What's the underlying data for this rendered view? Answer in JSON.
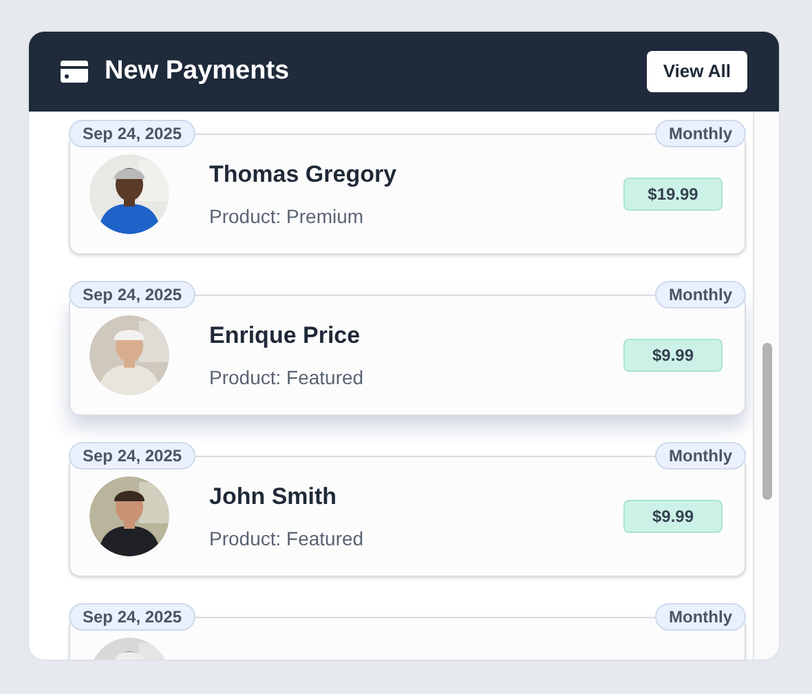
{
  "panel": {
    "title": "New Payments",
    "action": "View All"
  },
  "payments": [
    {
      "date": "Sep 24, 2025",
      "plan": "Monthly",
      "name": "Thomas Gregory",
      "product": "Product: Premium",
      "amount": "$19.99",
      "selected": false
    },
    {
      "date": "Sep 24, 2025",
      "plan": "Monthly",
      "name": "Enrique Price",
      "product": "Product: Featured",
      "amount": "$9.99",
      "selected": true
    },
    {
      "date": "Sep 24, 2025",
      "plan": "Monthly",
      "name": "John Smith",
      "product": "Product: Featured",
      "amount": "$9.99",
      "selected": false
    },
    {
      "date": "Sep 24, 2025",
      "plan": "Monthly"
    }
  ]
}
